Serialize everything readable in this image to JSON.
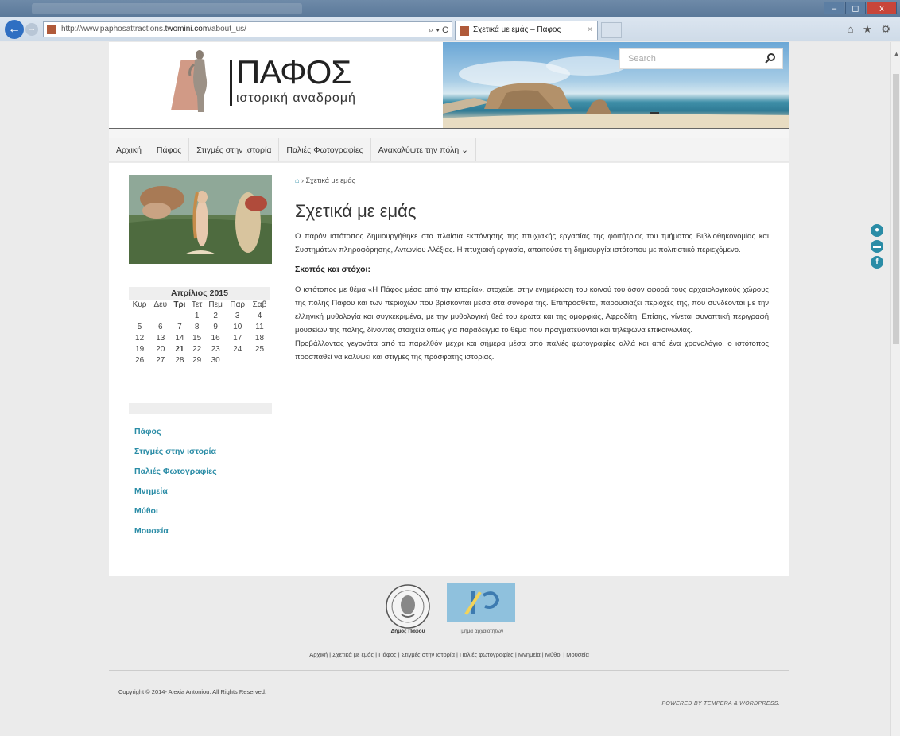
{
  "browser": {
    "url_prefix": "http://www.paphosattractions.",
    "url_domain": "twomini.com",
    "url_path": "/about_us/",
    "address_tools": "⌕ ▾ C",
    "tab_title": "Σχετικά με εμάς – Παφος",
    "tab_close": "×",
    "window_controls": [
      "–",
      "◻",
      "x"
    ],
    "chrome_icons": "⌂ ★ ⚙"
  },
  "site": {
    "logo_title": "ΠΑΦΟΣ",
    "logo_subtitle": "ιστορική αναδρομή",
    "search_placeholder": "Search"
  },
  "nav": {
    "items": [
      "Αρχική",
      "Πάφος",
      "Στιγμές στην ιστορία",
      "Παλιές Φωτογραφίες",
      "Ανακαλύψτε την πόλη ⌄"
    ]
  },
  "calendar": {
    "caption": "Απρίλιος 2015",
    "days": [
      "Κυρ",
      "Δευ",
      "Τρι",
      "Τετ",
      "Πεμ",
      "Παρ",
      "Σαβ"
    ],
    "weeks": [
      [
        "",
        "",
        "",
        "1",
        "2",
        "3",
        "4"
      ],
      [
        "5",
        "6",
        "7",
        "8",
        "9",
        "10",
        "11"
      ],
      [
        "12",
        "13",
        "14",
        "15",
        "16",
        "17",
        "18"
      ],
      [
        "19",
        "20",
        "21",
        "22",
        "23",
        "24",
        "25"
      ],
      [
        "26",
        "27",
        "28",
        "29",
        "30",
        "",
        ""
      ]
    ],
    "today": "21"
  },
  "sidebar_links": [
    "Πάφος",
    "Στιγμές στην ιστορία",
    "Παλιές Φωτογραφίες",
    "Μνημεία",
    "Μύθοι",
    "Μουσεία"
  ],
  "main": {
    "breadcrumb_sep": "›",
    "breadcrumb_current": "Σχετικά με εμάς",
    "title": "Σχετικά με εμάς",
    "intro": "Ο παρόν ιστότοπος δημιουργήθηκε στα πλαίσια εκπόνησης της πτυχιακής εργασίας της φοιτήτριας του τμήματος Βιβλιοθηκονομίας και Συστημάτων πληροφόρησης, Αντωνίου Αλέξιας. Η πτυχιακή εργασία, απαιτούσε τη δημιουργία ιστότοπου με πολιτιστικό περιεχόμενο.",
    "subheading": "Σκοπός και στόχοι:",
    "para1": "Ο ιστότοπος με θέμα «Η Πάφος μέσα από την ιστορία», στοχεύει στην ενημέρωση του κοινού του όσον αφορά τους αρχαιολογικούς χώρους της πόλης Πάφου και των περιοχών που βρίσκονται μέσα στα σύνορα της. Επιπρόσθετα, παρουσιάζει περιοχές της, που συνδέονται με την ελληνική μυθολογία και συγκεκριμένα, με την μυθολογική θεά του έρωτα και της ομορφιάς, Αφροδίτη. Επίσης, γίνεται συνοπτική περιγραφή μουσείων της πόλης, δίνοντας στοιχεία όπως για παράδειγμα το θέμα που πραγματεύονται και τηλέφωνα επικοινωνίας.",
    "para2": "Προβάλλοντας γεγονότα από το παρελθόν μέχρι και σήμερα μέσα από παλιές φωτογραφίες αλλά και από ένα χρονολόγιο, ο ιστότοπος προσπαθεί να καλύψει και στιγμές της πρόσφατης ιστορίας."
  },
  "footer": {
    "logo1_label": "Δήμος Πάφου",
    "logo2_label": "Τμήμα αρχαιοτήτων",
    "menu": "Αρχική | Σχετικά με εμάς | Πάφος | Στιγμές στην ιστορία | Παλιές φωτογραφίες | Μνημεία | Μύθοι | Μουσεία",
    "copyright": "Copyright © 2014- Alexia Antoniou. All Rights Reserved.",
    "powered": "POWERED BY TEMPERA & WORDPRESS."
  }
}
